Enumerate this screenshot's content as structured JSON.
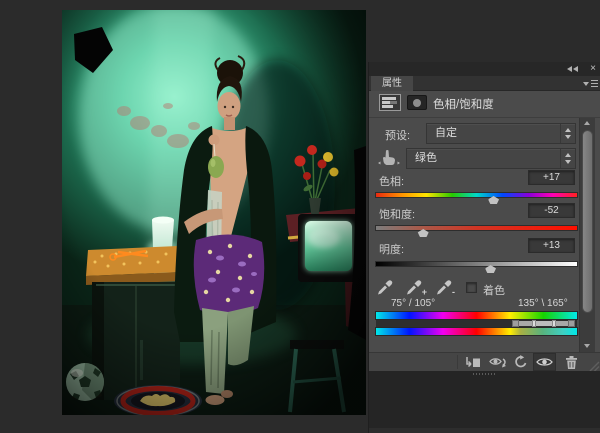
{
  "panel": {
    "titlebar": {
      "close_glyph": "×"
    },
    "tab_label": "属性",
    "header_title": "色相/饱和度",
    "preset_label": "预设:",
    "preset_value": "自定",
    "channel_value": "绿色",
    "sliders": {
      "hue": {
        "label": "色相:",
        "value": "+17",
        "percent": 58.5
      },
      "saturation": {
        "label": "饱和度:",
        "value": "-52",
        "percent": 23.5
      },
      "lightness": {
        "label": "明度:",
        "value": "+13",
        "percent": 57
      }
    },
    "colorize_label": "着色",
    "colorize_checked": false,
    "range_left_label": "75° / 105°",
    "range_right_label": "135° \\ 165°",
    "icons": {
      "dropper_plus": "+",
      "dropper_minus": "-"
    },
    "colors": {
      "canvas_bg": "#2b2b2b",
      "panel_bg": "#4b4b4b",
      "chrome_bg": "#272727",
      "tab_bg": "#464646",
      "value_box_bg": "#393939",
      "text": "#cccccc",
      "range_handle": "#9e9e9e"
    }
  },
  "photo": {
    "description": "Model in dark cardigan and purple paisley skirt standing in green-lit room with glowing TV, flowers, jug, soccer ball and round red rug"
  }
}
